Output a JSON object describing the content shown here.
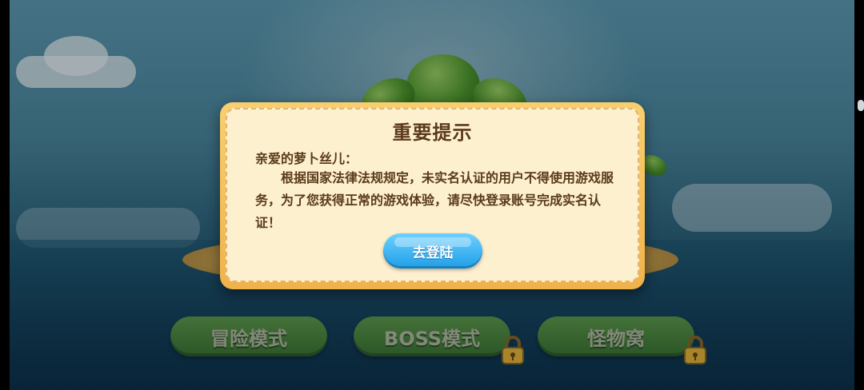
{
  "dialog": {
    "title": "重要提示",
    "greeting": "亲爱的萝卜丝儿：",
    "body": "根据国家法律法规规定，未实名认证的用户不得使用游戏服务，为了您获得正常的游戏体验，请尽快登录账号完成实名认证！",
    "login_button": "去登陆"
  },
  "modes": [
    {
      "label": "冒险模式",
      "locked": false
    },
    {
      "label": "BOSS模式",
      "locked": true
    },
    {
      "label": "怪物窝",
      "locked": true
    }
  ],
  "colors": {
    "dialog_border": "#f0b24b",
    "dialog_fill": "#fdf0cf",
    "title_text": "#5a3a1a",
    "login_button": "#1e9ee8",
    "mode_button": "#4e8f2a"
  },
  "icons": {
    "lock": "padlock-icon"
  }
}
